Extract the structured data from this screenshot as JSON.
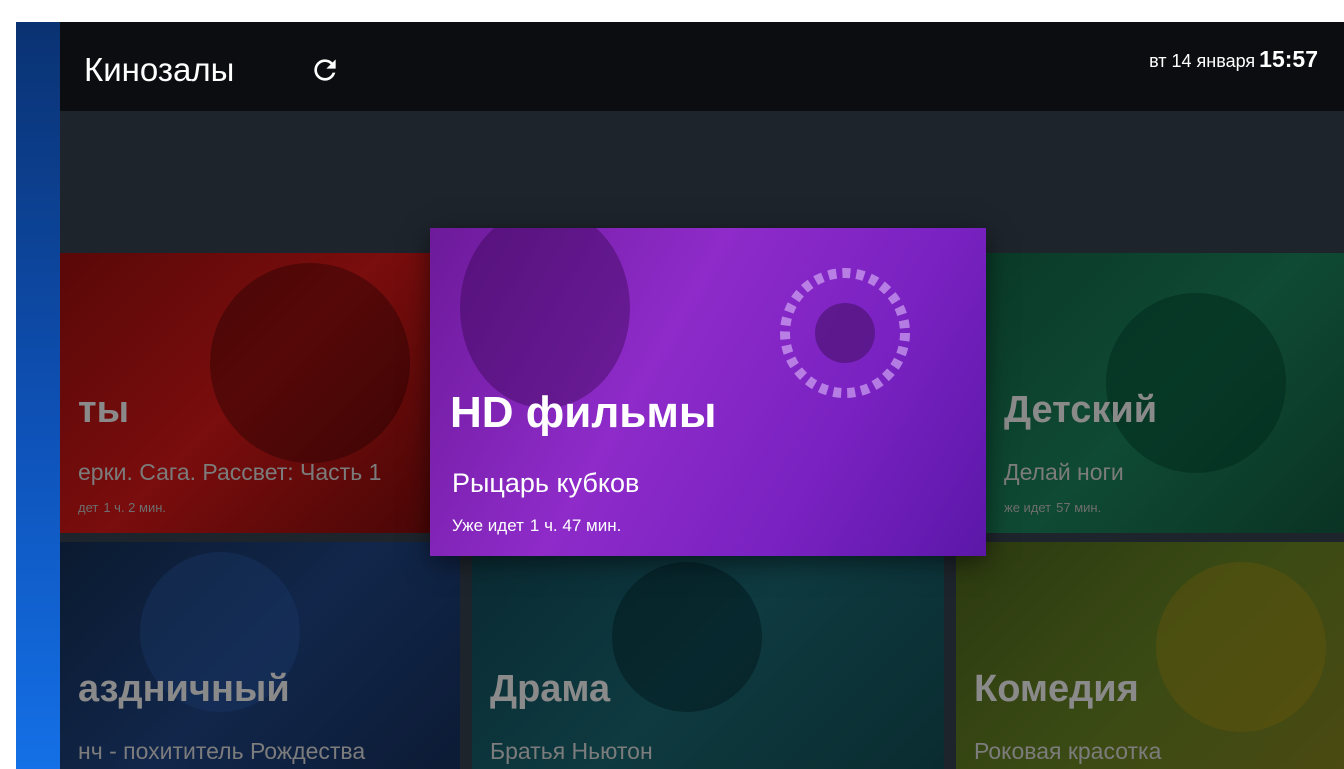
{
  "header": {
    "title": "Кинозалы",
    "refresh_icon": "refresh-icon",
    "date": "вт 14 января",
    "time": "15:57"
  },
  "colors": {
    "header_bg": "#0b0d10",
    "body_bg": "#1e242c",
    "sidebar_accent": "#1470e6",
    "focus_tile": "#8e2bc9"
  },
  "focused_tile": {
    "title": "HD фильмы",
    "movie": "Рыцарь кубков",
    "status": "Уже идет",
    "duration": "1 ч. 47 мин."
  },
  "tiles": [
    {
      "title": "ты",
      "movie": "ерки. Сага. Рассвет: Часть 1",
      "status": "дет",
      "duration": "1 ч. 2 мин."
    },
    {
      "title": "Детский",
      "movie": "Делай ноги",
      "status": "же идет",
      "duration": "57 мин."
    },
    {
      "title": "аздничный",
      "movie": "нч - похититель Рождества"
    },
    {
      "title": "Драма",
      "movie": "Братья Ньютон"
    },
    {
      "title": "Комедия",
      "movie": "Роковая красотка"
    }
  ]
}
